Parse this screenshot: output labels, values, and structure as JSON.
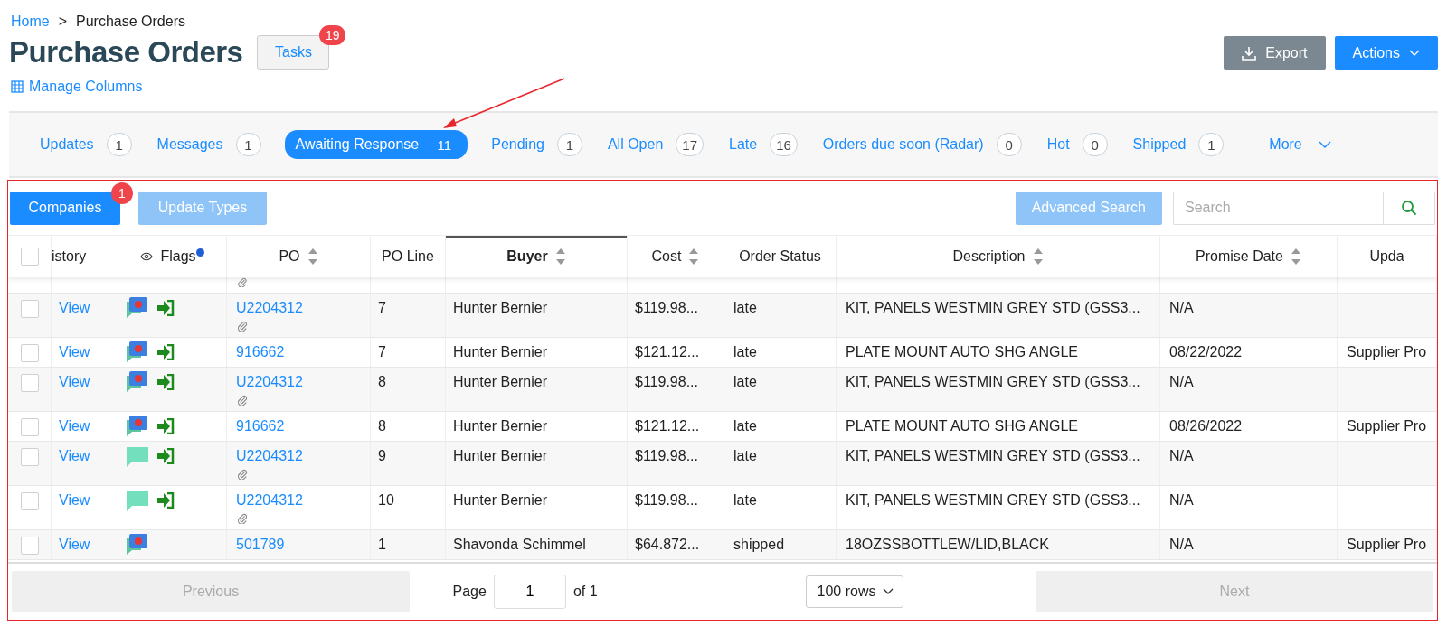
{
  "breadcrumb": {
    "home": "Home",
    "separator": ">",
    "current": "Purchase Orders"
  },
  "title": "Purchase Orders",
  "tasks": {
    "label": "Tasks",
    "count": "19"
  },
  "manage_columns": "Manage Columns",
  "header_buttons": [
    {
      "label": "Export",
      "kind": "export"
    },
    {
      "label": "Actions",
      "kind": "actions"
    }
  ],
  "filters": [
    {
      "label": "Updates",
      "count": "1",
      "selected": false
    },
    {
      "label": "Messages",
      "count": "1",
      "selected": false
    },
    {
      "label": "Awaiting Response",
      "count": "11",
      "selected": true
    },
    {
      "label": "Pending",
      "count": "1",
      "selected": false
    },
    {
      "label": "All Open",
      "count": "17",
      "selected": false
    },
    {
      "label": "Late",
      "count": "16",
      "selected": false
    },
    {
      "label": "Orders due soon (Radar)",
      "count": "0",
      "selected": false
    },
    {
      "label": "Hot",
      "count": "0",
      "selected": false
    },
    {
      "label": "Shipped",
      "count": "1",
      "selected": false
    }
  ],
  "more": "More",
  "toolbar": {
    "companies": {
      "label": "Companies",
      "count": "1"
    },
    "update_types": {
      "label": "Update Types",
      "disabled": true
    },
    "advanced_search": "Advanced Search",
    "search_placeholder": "Search"
  },
  "table": {
    "all_checked": false,
    "columns": [
      {
        "label": "istory",
        "sortable": false,
        "sorted": false
      },
      {
        "label": "Flags",
        "sortable": false,
        "sorted": false,
        "kind": "flags"
      },
      {
        "label": "PO",
        "sortable": true,
        "sorted": false
      },
      {
        "label": "PO Line",
        "sortable": false,
        "sorted": false
      },
      {
        "label": "Buyer",
        "sortable": true,
        "sorted": true
      },
      {
        "label": "Cost",
        "sortable": true,
        "sorted": false
      },
      {
        "label": "Order Status",
        "sortable": false,
        "sorted": false
      },
      {
        "label": "Description",
        "sortable": true,
        "sorted": false
      },
      {
        "label": "Promise Date",
        "sortable": true,
        "sorted": false
      },
      {
        "label": "Upda",
        "sortable": false,
        "sorted": false
      }
    ],
    "rows": [
      {
        "checked": false,
        "history": "View",
        "flags": [
          {
            "kind": "alert-chat"
          },
          {
            "kind": "sign-in"
          }
        ],
        "po": "U2204312",
        "attachment": true,
        "po_line": "7",
        "buyer": "Hunter Bernier",
        "cost": "$119.98...",
        "status": "late",
        "description": "KIT, PANELS WESTMIN GREY STD (GSS3...",
        "promise_date": "N/A"
      },
      {
        "checked": false,
        "history": "View",
        "flags": [
          {
            "kind": "alert-chat"
          },
          {
            "kind": "sign-in"
          }
        ],
        "po": "916662",
        "attachment": false,
        "po_line": "7",
        "buyer": "Hunter Bernier",
        "cost": "$121.12...",
        "status": "late",
        "description": "PLATE MOUNT AUTO SHG ANGLE",
        "promise_date": "08/22/2022",
        "update": "Supplier Pro"
      },
      {
        "checked": false,
        "history": "View",
        "flags": [
          {
            "kind": "alert-chat"
          },
          {
            "kind": "sign-in"
          }
        ],
        "po": "U2204312",
        "attachment": true,
        "po_line": "8",
        "buyer": "Hunter Bernier",
        "cost": "$119.98...",
        "status": "late",
        "description": "KIT, PANELS WESTMIN GREY STD (GSS3...",
        "promise_date": "N/A"
      },
      {
        "checked": false,
        "history": "View",
        "flags": [
          {
            "kind": "alert-chat"
          },
          {
            "kind": "sign-in"
          }
        ],
        "po": "916662",
        "attachment": false,
        "po_line": "8",
        "buyer": "Hunter Bernier",
        "cost": "$121.12...",
        "status": "late",
        "description": "PLATE MOUNT AUTO SHG ANGLE",
        "promise_date": "08/26/2022",
        "update": "Supplier Pro"
      },
      {
        "checked": false,
        "history": "View",
        "flags": [
          {
            "kind": "chat"
          },
          {
            "kind": "sign-in"
          }
        ],
        "po": "U2204312",
        "attachment": true,
        "po_line": "9",
        "buyer": "Hunter Bernier",
        "cost": "$119.98...",
        "status": "late",
        "description": "KIT, PANELS WESTMIN GREY STD (GSS3...",
        "promise_date": "N/A"
      },
      {
        "checked": false,
        "history": "View",
        "flags": [
          {
            "kind": "chat"
          },
          {
            "kind": "sign-in"
          }
        ],
        "po": "U2204312",
        "attachment": true,
        "po_line": "10",
        "buyer": "Hunter Bernier",
        "cost": "$119.98...",
        "status": "late",
        "description": "KIT, PANELS WESTMIN GREY STD (GSS3...",
        "promise_date": "N/A"
      },
      {
        "checked": false,
        "history": "View",
        "flags": [
          {
            "kind": "alert-chat"
          }
        ],
        "po": "501789",
        "attachment": false,
        "po_line": "1",
        "buyer": "Shavonda Schimmel",
        "cost": "$64.872...",
        "status": "shipped",
        "description": "18OZSSBOTTLEW/LID,BLACK",
        "promise_date": "N/A",
        "update": "Supplier Pro"
      }
    ]
  },
  "pagination": {
    "previous": "Previous",
    "page_label": "Page",
    "page": "1",
    "of": "of 1",
    "rows": "100 rows",
    "next": "Next"
  }
}
